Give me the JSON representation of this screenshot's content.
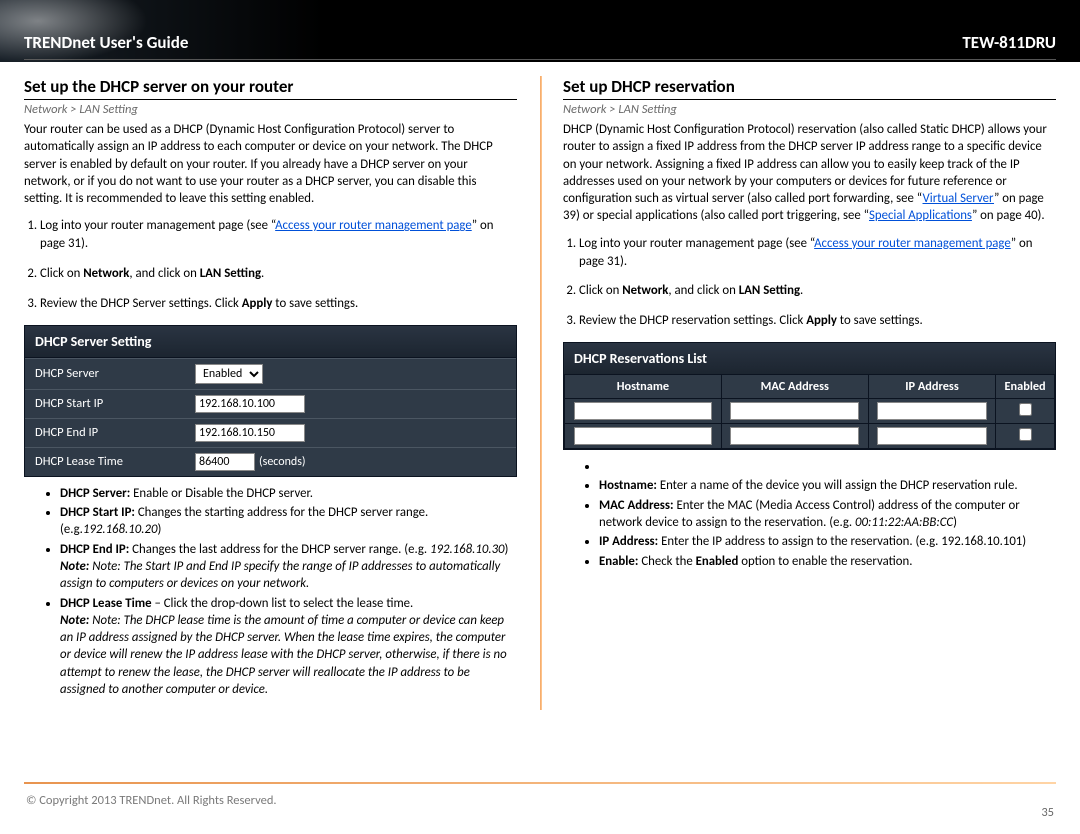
{
  "header": {
    "title": "TRENDnet User's Guide",
    "model": "TEW-811DRU"
  },
  "left": {
    "heading": "Set up the DHCP server on your router",
    "breadcrumb": "Network > LAN Setting",
    "intro": "Your router can be used as a DHCP (Dynamic Host Configuration Protocol) server to automatically assign an IP address to each computer or device on your network. The DHCP server is enabled by default on your router. If you already have a DHCP server on your network, or if you do not want to use your router as a DHCP server, you can disable this setting. It is recommended to leave this setting enabled.",
    "step1_pre": "Log into your router management page (see “",
    "step1_link": "Access your router management page",
    "step1_post": "” on page 31).",
    "step2_a": "Click on ",
    "step2_b": "Network",
    "step2_c": ", and click on ",
    "step2_d": "LAN Setting",
    "step2_e": ".",
    "step3_a": "Review the DHCP Server settings. Click ",
    "step3_b": "Apply",
    "step3_c": " to save settings.",
    "panel": {
      "title": "DHCP Server Setting",
      "rows": {
        "server": {
          "label": "DHCP Server",
          "value": "Enabled"
        },
        "start": {
          "label": "DHCP Start IP",
          "value": "192.168.10.100"
        },
        "end": {
          "label": "DHCP End IP",
          "value": "192.168.10.150"
        },
        "lease": {
          "label": "DHCP Lease Time",
          "value": "86400",
          "suffix": "(seconds)"
        }
      }
    },
    "bullets": {
      "b1_a": "DHCP Server:",
      "b1_b": " Enable or Disable the DHCP server.",
      "b2_a": "DHCP Start IP:",
      "b2_b": " Changes the starting address for the DHCP server range. (e.g.",
      "b2_c": "192.168.10.20",
      "b2_d": ")",
      "b3_a": "DHCP End IP:",
      "b3_b": " Changes the last address for the DHCP server range. (e.g. ",
      "b3_c": "192.168.10.30",
      "b3_d": ")",
      "b3_note": "Note: The Start IP and End IP specify the range of IP addresses to automatically assign to computers or devices on your network.",
      "b4_a": "DHCP Lease Time",
      "b4_b": " – Click the drop-down list to select the lease time.",
      "b4_note": "Note: The DHCP lease time is the amount of time a computer or device can keep an IP address assigned by the DHCP server. When the lease time expires, the computer or device will renew the IP address lease with the DHCP server, otherwise, if there is no attempt to renew the lease, the DHCP server will reallocate the IP address to be assigned to another computer or device."
    }
  },
  "right": {
    "heading": "Set up DHCP reservation",
    "breadcrumb": "Network > LAN Setting",
    "intro_a": "DHCP (Dynamic Host Configuration Protocol) reservation (also called Static DHCP) allows your router to assign a fixed IP address from the DHCP server IP address range to a specific device on your network. Assigning a fixed IP address can allow you to easily keep track of the IP addresses used on your network by your computers or devices for future reference or configuration such as virtual server (also called port forwarding, see “",
    "intro_link1": "Virtual Server",
    "intro_b": "” on page 39) or special applications (also called port triggering, see “",
    "intro_link2": "Special Applications",
    "intro_c": "” on page 40).",
    "step1_pre": "Log into your router management page (see “",
    "step1_link": "Access your router management page",
    "step1_post": "” on page 31).",
    "step2_a": "Click on ",
    "step2_b": "Network",
    "step2_c": ", and click on ",
    "step2_d": "LAN Setting",
    "step2_e": ".",
    "step3_a": "Review the DHCP reservation settings. Click ",
    "step3_b": "Apply",
    "step3_c": " to save settings.",
    "res_panel": {
      "title": "DHCP Reservations List",
      "cols": {
        "c1": "Hostname",
        "c2": "MAC Address",
        "c3": "IP Address",
        "c4": "Enabled"
      }
    },
    "bullets": {
      "b1_a": "Hostname:",
      "b1_b": " Enter a name of the device you will assign the DHCP reservation rule.",
      "b2_a": "MAC Address:",
      "b2_b": " Enter the MAC (Media Access Control) address of the computer or network device to assign to the reservation. (e.g. ",
      "b2_c": "00:11:22:AA:BB:CC",
      "b2_d": ")",
      "b3_a": "IP Address:",
      "b3_b": " Enter the IP address to assign to the reservation. (e.g. 192.168.10.101)",
      "b4_a": "Enable:",
      "b4_b": " Check the ",
      "b4_c": "Enabled",
      "b4_d": " option to enable the reservation."
    }
  },
  "footer": {
    "copyright": "© Copyright 2013 TRENDnet. All Rights Reserved.",
    "page": "35"
  }
}
